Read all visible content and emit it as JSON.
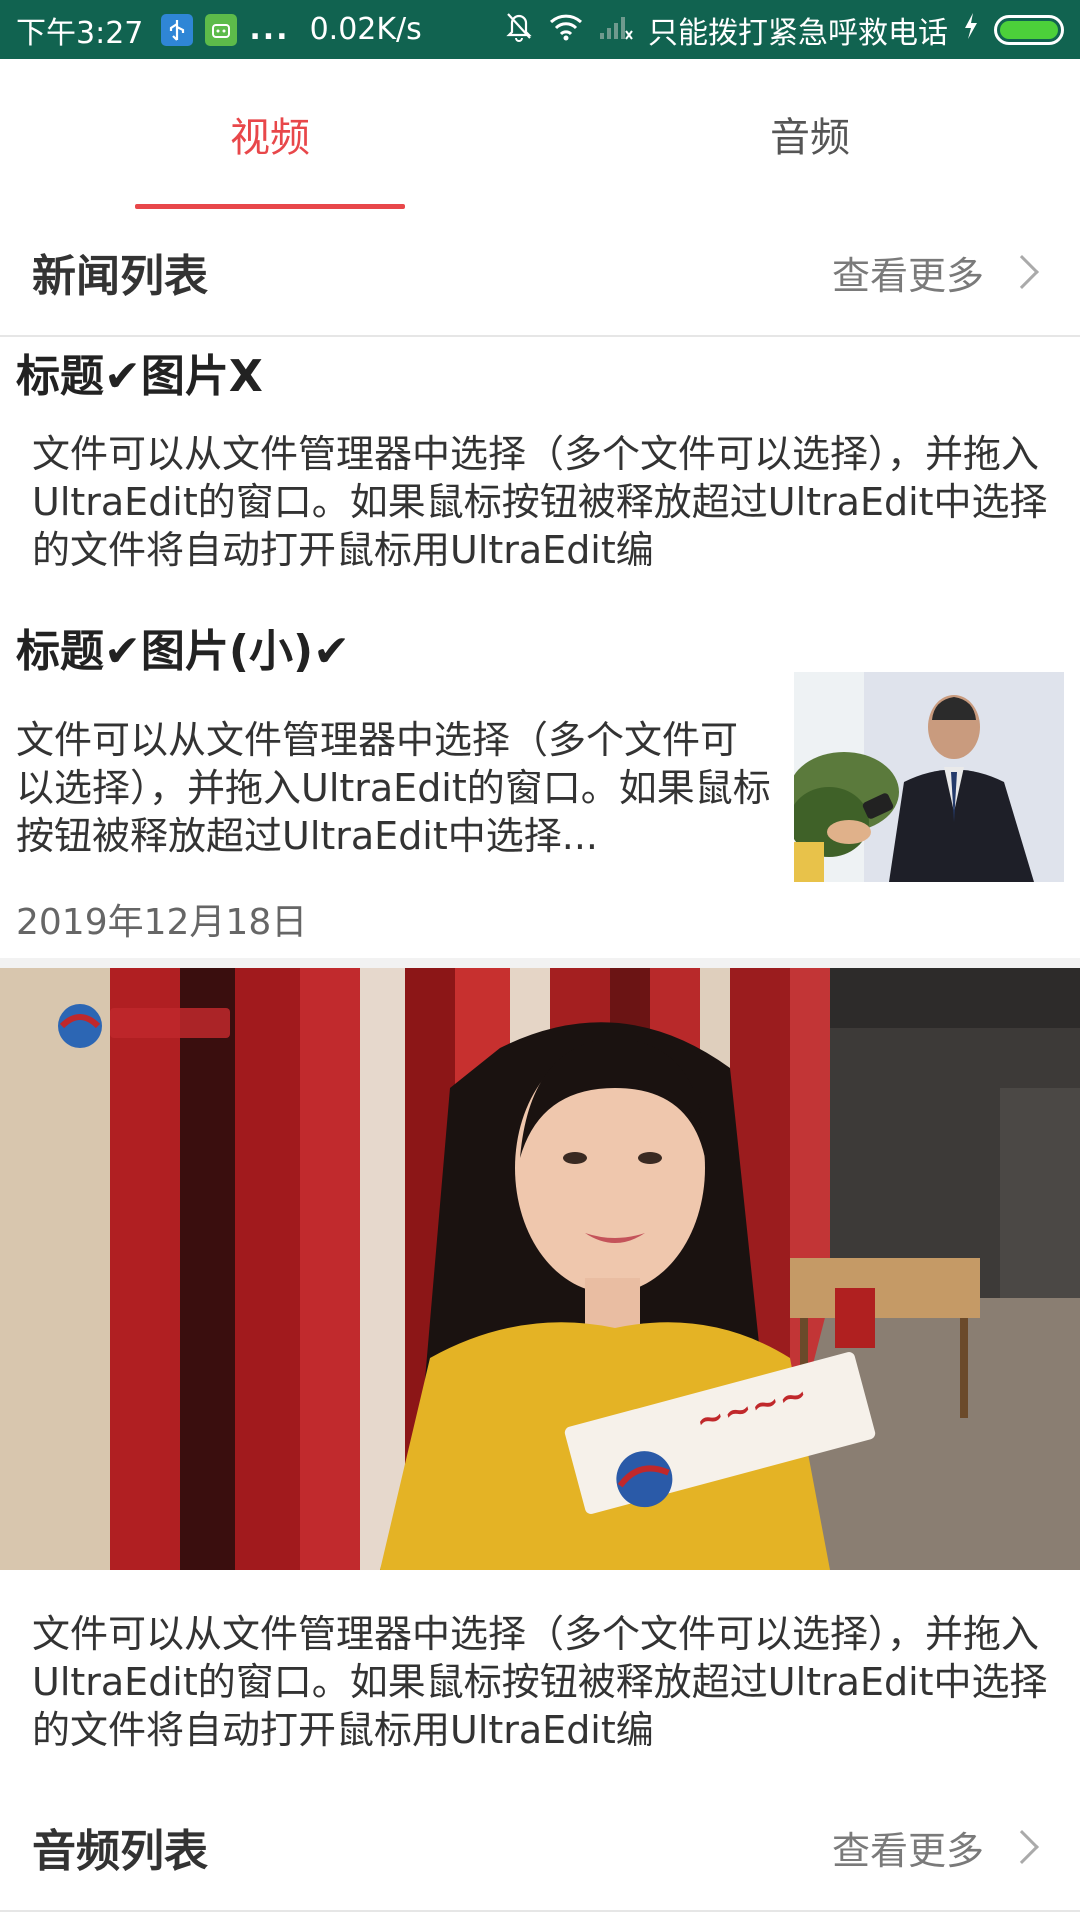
{
  "status_bar": {
    "time": "下午3:27",
    "more": "...",
    "speed": "0.02K/s",
    "carrier": "只能拨打紧急呼救电话",
    "icons": [
      "usb-icon",
      "android-icon",
      "bell-off-icon",
      "wifi-icon",
      "signal-icon",
      "charging-icon",
      "battery-icon"
    ]
  },
  "tabs": [
    {
      "label": "视频",
      "active": true
    },
    {
      "label": "音频",
      "active": false
    }
  ],
  "news_section": {
    "title": "新闻列表",
    "more": "查看更多"
  },
  "news_items": [
    {
      "title": "标题✔图片X",
      "body": "文件可以从文件管理器中选择（多个文件可以选择），并拖入UltraEdit的窗口。如果鼠标按钮被释放超过UltraEdit中选择的文件将自动打开鼠标用UltraEdit编"
    },
    {
      "title": "标题✔图片(小)✔",
      "body": "文件可以从文件管理器中选择（多个文件可以选择），并拖入UltraEdit的窗口。如果鼠标按钮被释放超过UltraEdit中选择...",
      "date": "2019年12月18日"
    },
    {
      "body": "文件可以从文件管理器中选择（多个文件可以选择），并拖入UltraEdit的窗口。如果鼠标按钮被释放超过UltraEdit中选择的文件将自动打开鼠标用UltraEdit编"
    }
  ],
  "audio_section": {
    "title": "音频列表",
    "more": "查看更多"
  },
  "colors": {
    "status_bar": "#116350",
    "accent": "#e8474a"
  }
}
